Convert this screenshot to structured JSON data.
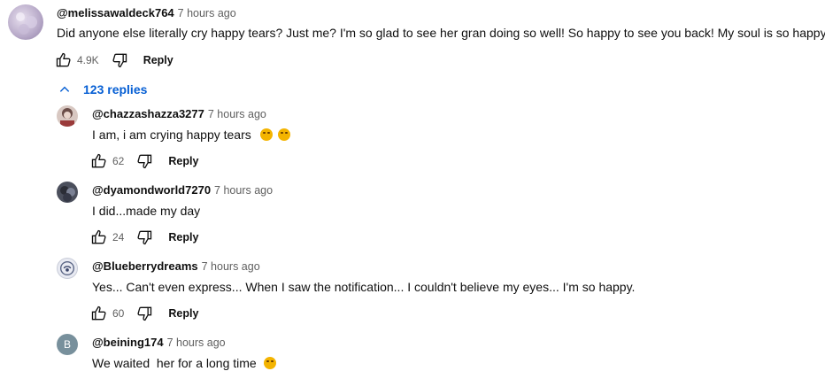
{
  "top_comment": {
    "author": "@melissawaldeck764",
    "time": "7 hours ago",
    "text": "Did anyone else literally cry happy tears? Just me? I'm so glad to see her gran doing so well! So happy to see you back! My soul is so happy",
    "likes": "4.9K",
    "reply_label": "Reply",
    "avatar_icon": "avatar-icon"
  },
  "replies_toggle": {
    "label": "123 replies",
    "color": "#065fd4"
  },
  "replies": [
    {
      "author": "@chazzashazza3277",
      "time": "7 hours ago",
      "text": "I am, i am crying happy tears",
      "emojis": [
        "crying-face-emoji",
        "crying-face-emoji"
      ],
      "likes": "62",
      "reply_label": "Reply"
    },
    {
      "author": "@dyamondworld7270",
      "time": "7 hours ago",
      "text": "I did...made my day",
      "likes": "24",
      "reply_label": "Reply"
    },
    {
      "author": "@Blueberrydreams",
      "time": "7 hours ago",
      "text": "Yes... Can't even express... When I saw the notification... I couldn't believe my eyes... I'm so happy.",
      "likes": "60",
      "reply_label": "Reply"
    },
    {
      "author": "@beining174",
      "time": "7 hours ago",
      "text": "We waited  her for a long time",
      "emojis": [
        "sad-face-emoji"
      ],
      "avatar_letter": "B"
    }
  ]
}
